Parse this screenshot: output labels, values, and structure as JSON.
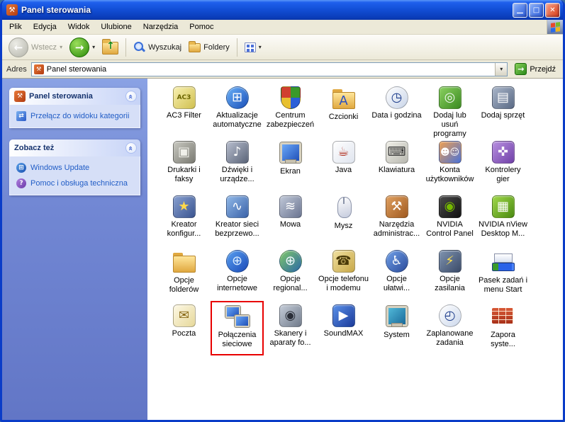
{
  "window": {
    "title": "Panel sterowania",
    "controls": {
      "minimize": "—",
      "maximize": "□",
      "close": "✕"
    }
  },
  "menubar": {
    "items": [
      "Plik",
      "Edycja",
      "Widok",
      "Ulubione",
      "Narzędzia",
      "Pomoc"
    ]
  },
  "toolbar": {
    "back": "Wstecz",
    "search": "Wyszukaj",
    "folders": "Foldery"
  },
  "addressbar": {
    "label": "Adres",
    "value": "Panel sterowania",
    "go": "Przejdź"
  },
  "ui_glyphs": {
    "back_arrow": "←",
    "forward_arrow": "→",
    "up_arrow": "↑",
    "caret": "▾",
    "chevron": "«",
    "go_arrow": "→",
    "panel_icon": "⚒",
    "switch": "⇄",
    "update": "⊞",
    "help": "?"
  },
  "sidebar": {
    "panels": [
      {
        "title": "Panel sterowania",
        "links": [
          {
            "label": "Przełącz do widoku kategorii",
            "icon": "switch-category-view-icon"
          }
        ]
      },
      {
        "title": "Zobacz też",
        "links": [
          {
            "label": "Windows Update",
            "icon": "windows-update-icon"
          },
          {
            "label": "Pomoc i obsługa techniczna",
            "icon": "help-support-icon"
          }
        ]
      }
    ]
  },
  "content": {
    "highlight_color": "#e80000",
    "items": [
      {
        "label": "AC3 Filter",
        "icon": "ac3-filter-icon",
        "shape": "square",
        "glyph": "AC3",
        "fg": "#6a6400",
        "c1": "#f8f0b0",
        "c2": "#d0c050"
      },
      {
        "label": "Aktualizacje\nautomatyczne",
        "icon": "automatic-updates-icon",
        "shape": "circle",
        "glyph": "⊞",
        "fg": "#ffffff",
        "c1": "#6ab0f8",
        "c2": "#1a50b8"
      },
      {
        "label": "Centrum\nzabezpieczeń",
        "icon": "security-center-icon",
        "shape": "shield",
        "glyph": "",
        "fg": "#ffffff"
      },
      {
        "label": "Czcionki",
        "icon": "fonts-icon",
        "shape": "folder",
        "glyph": "A",
        "fg": "#2a50c0",
        "c1": "#ffe69a",
        "c2": "#e0a840"
      },
      {
        "label": "Data i godzina",
        "icon": "date-time-icon",
        "shape": "circle",
        "glyph": "◷",
        "fg": "#1a3a8a",
        "c1": "#ffffff",
        "c2": "#c8d4e8"
      },
      {
        "label": "Dodaj lub usuń\nprogramy",
        "icon": "add-remove-programs-icon",
        "shape": "square",
        "glyph": "◎",
        "fg": "#eef8ee",
        "c1": "#8ad060",
        "c2": "#3a8a20"
      },
      {
        "label": "Dodaj sprzęt",
        "icon": "add-hardware-icon",
        "shape": "square",
        "glyph": "▤",
        "fg": "#ffffff",
        "c1": "#a8b4c8",
        "c2": "#5a6a85"
      },
      {
        "label": "Drukarki i\nfaksy",
        "icon": "printers-faxes-icon",
        "shape": "square",
        "glyph": "▣",
        "fg": "#f0f0ea",
        "c1": "#c8c8c0",
        "c2": "#7a7a72"
      },
      {
        "label": "Dźwięki i\nurządze...",
        "icon": "sounds-audio-devices-icon",
        "shape": "square",
        "glyph": "♪",
        "fg": "#ffffff",
        "c1": "#b8bece",
        "c2": "#5a6478"
      },
      {
        "label": "Ekran",
        "icon": "display-icon",
        "shape": "monitor",
        "glyph": "",
        "c1": "#6aa8f8",
        "c2": "#2050b8"
      },
      {
        "label": "Java",
        "icon": "java-icon",
        "shape": "square",
        "glyph": "☕",
        "fg": "#b03020",
        "c1": "#ffffff",
        "c2": "#dfe4ee"
      },
      {
        "label": "Klawiatura",
        "icon": "keyboard-icon",
        "shape": "square",
        "glyph": "⌨",
        "fg": "#3a3a3a",
        "c1": "#f0efe8",
        "c2": "#b8b8b0"
      },
      {
        "label": "Konta\nużytkowników",
        "icon": "user-accounts-icon",
        "shape": "square",
        "glyph": "☻☺",
        "fg": "#ffffff",
        "c1": "#f0a050",
        "c2": "#4a72d8"
      },
      {
        "label": "Kontrolery gier",
        "icon": "game-controllers-icon",
        "shape": "square",
        "glyph": "✜",
        "fg": "#ffffff",
        "c1": "#b890e0",
        "c2": "#7040a8"
      },
      {
        "label": "Kreator\nkonfigur...",
        "icon": "network-setup-wizard-icon",
        "shape": "square",
        "glyph": "★",
        "fg": "#ffd84a",
        "c1": "#88a0d0",
        "c2": "#3a5490"
      },
      {
        "label": "Kreator sieci\nbezprzewo...",
        "icon": "wireless-network-wizard-icon",
        "shape": "square",
        "glyph": "∿",
        "fg": "#ffffff",
        "c1": "#90b8e8",
        "c2": "#3a62a8"
      },
      {
        "label": "Mowa",
        "icon": "speech-icon",
        "shape": "square",
        "glyph": "≋",
        "fg": "#ffffff",
        "c1": "#c0c8d8",
        "c2": "#6a7490"
      },
      {
        "label": "Mysz",
        "icon": "mouse-icon",
        "shape": "mouse",
        "glyph": ""
      },
      {
        "label": "Narzędzia\nadministrac...",
        "icon": "administrative-tools-icon",
        "shape": "square",
        "glyph": "⚒",
        "fg": "#ffffff",
        "c1": "#e0a060",
        "c2": "#a05a20"
      },
      {
        "label": "NVIDIA\nControl Panel",
        "icon": "nvidia-control-panel-icon",
        "shape": "square",
        "glyph": "◉",
        "fg": "#76b900",
        "c1": "#4a4a4a",
        "c2": "#101010"
      },
      {
        "label": "NVIDIA nView\nDesktop M...",
        "icon": "nvidia-nview-desktop-manager-icon",
        "shape": "square",
        "glyph": "▦",
        "fg": "#ffffff",
        "c1": "#a0d84a",
        "c2": "#4a8a10"
      },
      {
        "label": "Opcje\nfolderów",
        "icon": "folder-options-icon",
        "shape": "folder",
        "glyph": "",
        "c1": "#ffe69a",
        "c2": "#e0a840"
      },
      {
        "label": "Opcje\ninternetowe",
        "icon": "internet-options-icon",
        "shape": "circle",
        "glyph": "⊕",
        "fg": "#d8ecff",
        "c1": "#5aa0f0",
        "c2": "#1a4ab8"
      },
      {
        "label": "Opcje\nregional...",
        "icon": "regional-language-options-icon",
        "shape": "circle",
        "glyph": "⊕",
        "fg": "#f0f8ff",
        "c1": "#80c868",
        "c2": "#2a68a8"
      },
      {
        "label": "Opcje telefonu\ni modemu",
        "icon": "phone-modem-options-icon",
        "shape": "square",
        "glyph": "☎",
        "fg": "#4a3a08",
        "c1": "#f0e0a0",
        "c2": "#c8a848"
      },
      {
        "label": "Opcje\nułatwi...",
        "icon": "accessibility-options-icon",
        "shape": "circle",
        "glyph": "♿",
        "fg": "#ffffff",
        "c1": "#70a0e8",
        "c2": "#2a4a9a"
      },
      {
        "label": "Opcje zasilania",
        "icon": "power-options-icon",
        "shape": "square",
        "glyph": "⚡",
        "fg": "#ffe04a",
        "c1": "#8094b0",
        "c2": "#3a4a68"
      },
      {
        "label": "Pasek zadań i\nmenu Start",
        "icon": "taskbar-start-menu-icon",
        "shape": "taskbar",
        "glyph": ""
      },
      {
        "label": "Poczta",
        "icon": "mail-icon",
        "shape": "square",
        "glyph": "✉",
        "fg": "#8a6a18",
        "c1": "#fdf8e4",
        "c2": "#e6d89a"
      },
      {
        "label": "Połączenia\nsieciowe",
        "icon": "network-connections-icon",
        "shape": "network",
        "glyph": "",
        "highlight": true
      },
      {
        "label": "Skanery i\naparaty fo...",
        "icon": "scanners-cameras-icon",
        "shape": "square",
        "glyph": "◉",
        "fg": "#2a2e38",
        "c1": "#c4ccd8",
        "c2": "#707a8a"
      },
      {
        "label": "SoundMAX",
        "icon": "soundmax-icon",
        "shape": "square",
        "glyph": "▶",
        "fg": "#ffffff",
        "c1": "#5a90e8",
        "c2": "#1a3a9a"
      },
      {
        "label": "System",
        "icon": "system-icon",
        "shape": "monitor",
        "glyph": "",
        "c1": "#50b8d8",
        "c2": "#1a6a9a"
      },
      {
        "label": "Zaplanowane\nzadania",
        "icon": "scheduled-tasks-icon",
        "shape": "circle",
        "glyph": "◴",
        "fg": "#1a3a8a",
        "c1": "#ffffff",
        "c2": "#ccd8ec"
      },
      {
        "label": "Zapora\nsyste...",
        "icon": "windows-firewall-icon",
        "shape": "wall",
        "glyph": ""
      }
    ]
  }
}
